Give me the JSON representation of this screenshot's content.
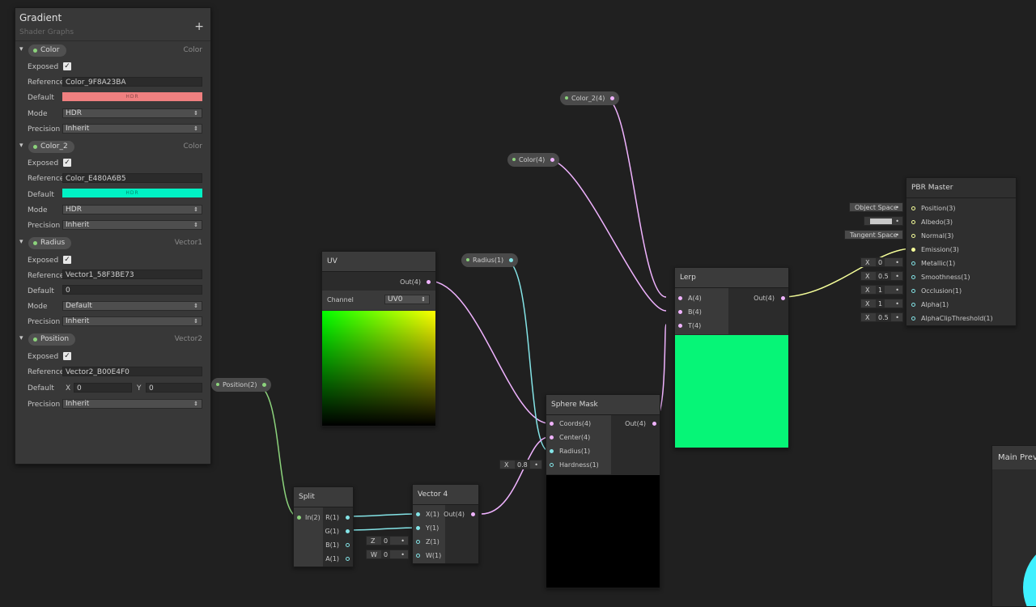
{
  "blackboard": {
    "title": "Gradient",
    "subtitle": "Shader Graphs",
    "add_icon": "+",
    "check": "✓",
    "properties": [
      {
        "name": "Color",
        "type": "Color",
        "rows": {
          "exposed": "Exposed",
          "reference_label": "Reference",
          "reference": "Color_9F8A23BA",
          "default_label": "Default",
          "default_color": "#f08080",
          "swatch_text": "HDR",
          "mode_label": "Mode",
          "mode": "HDR",
          "precision_label": "Precision",
          "precision": "Inherit"
        }
      },
      {
        "name": "Color_2",
        "type": "Color",
        "rows": {
          "exposed": "Exposed",
          "reference_label": "Reference",
          "reference": "Color_E480A6B5",
          "default_label": "Default",
          "default_color": "#00f2c4",
          "swatch_text": "HDR",
          "mode_label": "Mode",
          "mode": "HDR",
          "precision_label": "Precision",
          "precision": "Inherit"
        }
      },
      {
        "name": "Radius",
        "type": "Vector1",
        "rows": {
          "exposed": "Exposed",
          "reference_label": "Reference",
          "reference": "Vector1_58F3BE73",
          "default_label": "Default",
          "default": "0",
          "mode_label": "Mode",
          "mode": "Default",
          "precision_label": "Precision",
          "precision": "Inherit"
        }
      },
      {
        "name": "Position",
        "type": "Vector2",
        "rows": {
          "exposed": "Exposed",
          "reference_label": "Reference",
          "reference": "Vector2_B00E4F0",
          "default_label": "Default",
          "x_label": "X",
          "x": "0",
          "y_label": "Y",
          "y": "0",
          "precision_label": "Precision",
          "precision": "Inherit"
        }
      }
    ]
  },
  "property_nodes": {
    "color2": "Color_2(4)",
    "color": "Color(4)",
    "radius": "Radius(1)",
    "position": "Position(2)"
  },
  "uv_node": {
    "title": "UV",
    "out": "Out(4)",
    "channel_label": "Channel",
    "channel": "UV0"
  },
  "split_node": {
    "title": "Split",
    "in": "In(2)",
    "r": "R(1)",
    "g": "G(1)",
    "b": "B(1)",
    "a": "A(1)"
  },
  "vector4_node": {
    "title": "Vector 4",
    "x": "X(1)",
    "y": "Y(1)",
    "z": "Z(1)",
    "w": "W(1)",
    "out": "Out(4)",
    "z_label": "Z",
    "z_val": "0",
    "w_label": "W",
    "w_val": "0"
  },
  "sphere_mask_node": {
    "title": "Sphere Mask",
    "coords": "Coords(4)",
    "center": "Center(4)",
    "radius": "Radius(1)",
    "hardness": "Hardness(1)",
    "out": "Out(4)",
    "hard_label": "X",
    "hard_val": "0.8"
  },
  "lerp_node": {
    "title": "Lerp",
    "a": "A(4)",
    "b": "B(4)",
    "t": "T(4)",
    "out": "Out(4)",
    "preview_color": "#06f577"
  },
  "pbr_master": {
    "title": "PBR Master",
    "ports": [
      "Position(3)",
      "Albedo(3)",
      "Normal(3)",
      "Emission(3)",
      "Metallic(1)",
      "Smoothness(1)",
      "Occlusion(1)",
      "Alpha(1)",
      "AlphaClipThreshold(1)"
    ],
    "position_space": "Object Space",
    "normal_space": "Tangent Space",
    "albedo_color": "#c8c8c8",
    "metallic_label": "X",
    "metallic": "0",
    "smoothness_label": "X",
    "smoothness": "0.5",
    "occlusion_label": "X",
    "occlusion": "1",
    "alpha_label": "X",
    "alpha": "1",
    "clip_label": "X",
    "clip": "0.5"
  },
  "main_preview": {
    "title": "Main Previe"
  },
  "colors": {
    "pink_wire": "#f0b3ff",
    "cyan_wire": "#84e4e7",
    "green_wire": "#8cd37c",
    "yellow_wire": "#f6ff9a"
  }
}
